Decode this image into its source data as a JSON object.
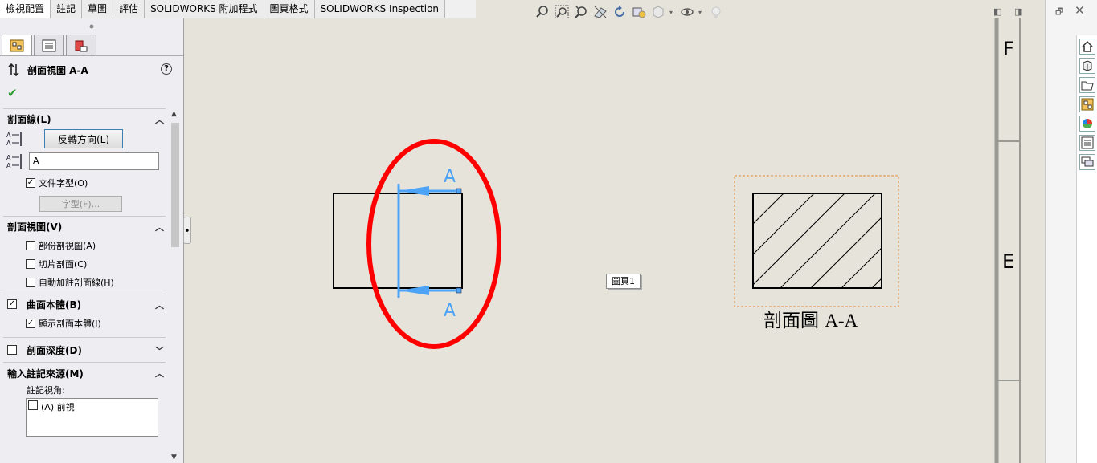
{
  "tabs": [
    "檢視配置",
    "註記",
    "草圖",
    "評估",
    "SOLIDWORKS 附加程式",
    "圖頁格式",
    "SOLIDWORKS Inspection"
  ],
  "hud_icons": [
    "zoom-to-fit-icon",
    "zoom-area-icon",
    "previous-view-icon",
    "section-view-icon",
    "rotate-icon",
    "view-orientation-icon",
    "display-style-icon",
    "hide-show-icon",
    "lighting-icon"
  ],
  "panel": {
    "title": "剖面視圖 A-A",
    "groups": {
      "cutting_line": {
        "title": "割面線(L)",
        "flip_button": "反轉方向(L)",
        "label_value": "A",
        "doc_font_label": "文件字型(O)",
        "font_button": "字型(F)..."
      },
      "section_view": {
        "title": "剖面視圖(V)",
        "opt_partial": "部份剖視圖(A)",
        "opt_slice": "切片剖面(C)",
        "opt_auto_hatch": "自動加註剖面線(H)"
      },
      "surface_bodies": {
        "title": "曲面本體(B)",
        "opt_show": "顯示剖面本體(I)"
      },
      "section_depth": {
        "title": "剖面深度(D)"
      },
      "import_annotations": {
        "title": "輸入註記來源(M)",
        "views_label": "註記視角:",
        "item_front": "(A) 前視"
      }
    }
  },
  "canvas": {
    "cut_label_top": "A",
    "cut_label_bottom": "A",
    "sheet_label": "圖頁1",
    "section_caption_cjk": "剖面圖",
    "section_caption_letters": "A-A",
    "zone_f": "F",
    "zone_e": "E"
  },
  "colors": {
    "section_line": "#4da3f5",
    "highlight_circle": "#ff0000",
    "bbox_dash": "#e08a3a"
  }
}
